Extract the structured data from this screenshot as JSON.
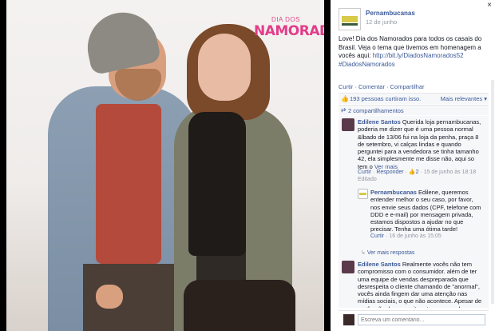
{
  "photo": {
    "brand_small": "DIA DOS",
    "brand_big": "NAMORADOS"
  },
  "panel": {
    "close_icon": "×",
    "page_name": "Pernambucanas",
    "date": "12 de junho",
    "post_text_1": "Love! Dia dos Namorados para todos os casais do Brasil. Veja o tema que tivemos em homenagem a vocês aqui: ",
    "post_link": "http://bit.ly/DiadosNamorados52",
    "post_hashtag": "#DiadosNamorados",
    "actions": {
      "like": "Curtir",
      "comment": "Comentar",
      "share": "Compartilhar"
    },
    "likes": "193 pessoas curtiram isso.",
    "relevance": "Mais relevantes ▾",
    "shares": "2 compartilhamentos",
    "comments": [
      {
        "author": "Edilene Santos",
        "text": "Querida loja pernambucanas, poderia me dizer que é uma pessoa normal &lbado de 13/06 fui na loja da penha, praça 8 de setembro, vi calças lindas e quando perguntei para a vendedora se tinha tamanho 42, ela simplesmente me disse não, aqui so tem o",
        "see_more": "Ver mais",
        "like": "Curtir",
        "reply": "Responder",
        "likes_count": "2",
        "date": "15 de junho às 18:18",
        "edited": "Editado"
      },
      {
        "author": "Pernambucanas",
        "text": "Edilene, queremos entender melhor o seu caso, por favor, nos envie seus dados (CPF, telefone com DDD e e-mail) por mensagem privada, estamos dispostos a ajudar no que precisar. Tenha uma ótima tarde!",
        "like": "Curtir",
        "date": "16 de junho às 15:05"
      }
    ],
    "more_replies": "Ver mais respostas",
    "comment3": {
      "author": "Edilene Santos",
      "text": "Realmente vocês não tem compromisso com o consumidor. além de ter uma equipe de vendas despreparada que desrespeita o cliente chamando de \"anormal\", vocês ainda fingem dar uma atenção nas mídias sociais, o que não acontece. Apesar de vocês não darem muito retorno no reclame aqui, vou"
    },
    "composer_placeholder": "Escreva um comentário..."
  }
}
